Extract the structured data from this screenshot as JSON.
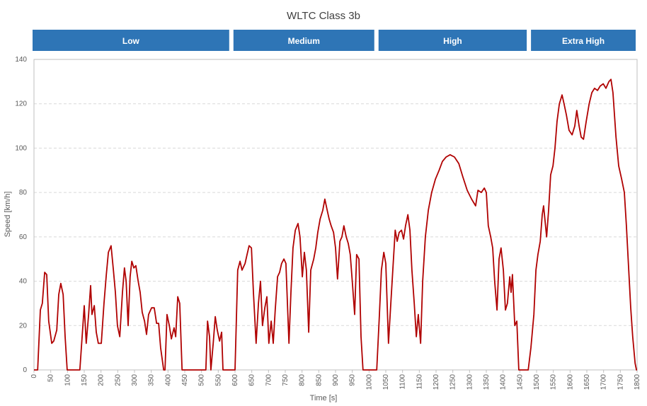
{
  "chart_data": {
    "type": "line",
    "title": "WLTC Class 3b",
    "xlabel": "Time [s]",
    "ylabel": "Speed [km/h]",
    "xlim": [
      0,
      1800
    ],
    "ylim": [
      0,
      140
    ],
    "xticks": [
      0,
      50,
      100,
      150,
      200,
      250,
      300,
      350,
      400,
      450,
      500,
      550,
      600,
      650,
      700,
      750,
      800,
      850,
      900,
      950,
      1000,
      1050,
      1100,
      1150,
      1200,
      1250,
      1300,
      1350,
      1400,
      1450,
      1500,
      1550,
      1600,
      1650,
      1700,
      1750,
      1800
    ],
    "yticks": [
      0,
      20,
      40,
      60,
      80,
      100,
      120,
      140
    ],
    "grid": "horizontal dashed",
    "line_color": "#b00000",
    "phase_color": "#2e75b6",
    "phases": [
      {
        "label": "Low",
        "start": 0,
        "end": 589
      },
      {
        "label": "Medium",
        "start": 589,
        "end": 1022
      },
      {
        "label": "High",
        "start": 1022,
        "end": 1477
      },
      {
        "label": "Extra High",
        "start": 1477,
        "end": 1800
      }
    ],
    "points": [
      [
        0,
        0
      ],
      [
        11,
        0
      ],
      [
        19,
        27
      ],
      [
        25,
        30
      ],
      [
        32,
        44
      ],
      [
        38,
        43
      ],
      [
        44,
        22
      ],
      [
        53,
        12
      ],
      [
        59,
        13
      ],
      [
        68,
        18
      ],
      [
        74,
        34
      ],
      [
        80,
        39
      ],
      [
        87,
        34
      ],
      [
        93,
        15
      ],
      [
        99,
        0
      ],
      [
        137,
        0
      ],
      [
        146,
        20
      ],
      [
        150,
        29
      ],
      [
        156,
        12
      ],
      [
        163,
        25
      ],
      [
        169,
        38
      ],
      [
        173,
        25
      ],
      [
        180,
        29
      ],
      [
        186,
        17
      ],
      [
        192,
        12
      ],
      [
        201,
        12
      ],
      [
        209,
        30
      ],
      [
        216,
        43
      ],
      [
        222,
        53
      ],
      [
        230,
        56
      ],
      [
        237,
        45
      ],
      [
        243,
        35
      ],
      [
        249,
        20
      ],
      [
        256,
        15
      ],
      [
        264,
        35
      ],
      [
        270,
        46
      ],
      [
        275,
        40
      ],
      [
        281,
        20
      ],
      [
        287,
        42
      ],
      [
        292,
        49
      ],
      [
        298,
        46
      ],
      [
        304,
        47
      ],
      [
        311,
        40
      ],
      [
        317,
        35
      ],
      [
        323,
        26
      ],
      [
        330,
        22
      ],
      [
        336,
        16
      ],
      [
        342,
        25
      ],
      [
        351,
        28
      ],
      [
        359,
        28
      ],
      [
        366,
        21
      ],
      [
        372,
        21
      ],
      [
        378,
        10
      ],
      [
        387,
        0
      ],
      [
        391,
        0
      ],
      [
        397,
        25
      ],
      [
        404,
        20
      ],
      [
        410,
        14
      ],
      [
        418,
        19
      ],
      [
        423,
        15
      ],
      [
        429,
        33
      ],
      [
        435,
        30
      ],
      [
        442,
        0
      ],
      [
        513,
        0
      ],
      [
        518,
        22
      ],
      [
        524,
        15
      ],
      [
        528,
        0
      ],
      [
        535,
        12
      ],
      [
        541,
        24
      ],
      [
        547,
        18
      ],
      [
        554,
        13
      ],
      [
        560,
        17
      ],
      [
        564,
        0
      ],
      [
        600,
        0
      ],
      [
        608,
        45
      ],
      [
        615,
        49
      ],
      [
        621,
        45
      ],
      [
        630,
        48
      ],
      [
        636,
        52
      ],
      [
        642,
        56
      ],
      [
        649,
        55
      ],
      [
        655,
        35
      ],
      [
        663,
        12
      ],
      [
        670,
        30
      ],
      [
        676,
        40
      ],
      [
        682,
        20
      ],
      [
        689,
        28
      ],
      [
        695,
        33
      ],
      [
        701,
        12
      ],
      [
        708,
        22
      ],
      [
        714,
        12
      ],
      [
        720,
        27
      ],
      [
        727,
        42
      ],
      [
        733,
        44
      ],
      [
        739,
        48
      ],
      [
        746,
        50
      ],
      [
        752,
        48
      ],
      [
        761,
        12
      ],
      [
        767,
        35
      ],
      [
        773,
        55
      ],
      [
        780,
        63
      ],
      [
        788,
        66
      ],
      [
        794,
        60
      ],
      [
        801,
        42
      ],
      [
        807,
        53
      ],
      [
        813,
        45
      ],
      [
        820,
        17
      ],
      [
        826,
        45
      ],
      [
        835,
        50
      ],
      [
        841,
        55
      ],
      [
        847,
        62
      ],
      [
        854,
        68
      ],
      [
        862,
        72
      ],
      [
        868,
        77
      ],
      [
        875,
        72
      ],
      [
        881,
        68
      ],
      [
        887,
        65
      ],
      [
        894,
        62
      ],
      [
        900,
        55
      ],
      [
        906,
        41
      ],
      [
        913,
        58
      ],
      [
        919,
        60
      ],
      [
        925,
        65
      ],
      [
        932,
        60
      ],
      [
        938,
        57
      ],
      [
        944,
        52
      ],
      [
        951,
        38
      ],
      [
        957,
        25
      ],
      [
        963,
        52
      ],
      [
        970,
        50
      ],
      [
        976,
        15
      ],
      [
        982,
        0
      ],
      [
        1023,
        0
      ],
      [
        1031,
        25
      ],
      [
        1037,
        45
      ],
      [
        1044,
        53
      ],
      [
        1050,
        48
      ],
      [
        1058,
        12
      ],
      [
        1065,
        30
      ],
      [
        1071,
        45
      ],
      [
        1078,
        63
      ],
      [
        1084,
        58
      ],
      [
        1090,
        62
      ],
      [
        1097,
        63
      ],
      [
        1103,
        59
      ],
      [
        1109,
        65
      ],
      [
        1116,
        70
      ],
      [
        1122,
        63
      ],
      [
        1128,
        45
      ],
      [
        1135,
        30
      ],
      [
        1141,
        15
      ],
      [
        1147,
        25
      ],
      [
        1154,
        12
      ],
      [
        1160,
        40
      ],
      [
        1168,
        60
      ],
      [
        1177,
        72
      ],
      [
        1187,
        80
      ],
      [
        1198,
        86
      ],
      [
        1209,
        90
      ],
      [
        1219,
        94
      ],
      [
        1230,
        96
      ],
      [
        1242,
        97
      ],
      [
        1255,
        96
      ],
      [
        1268,
        93
      ],
      [
        1280,
        87
      ],
      [
        1293,
        81
      ],
      [
        1306,
        77
      ],
      [
        1318,
        74
      ],
      [
        1325,
        81
      ],
      [
        1335,
        80
      ],
      [
        1344,
        82
      ],
      [
        1350,
        80
      ],
      [
        1356,
        65
      ],
      [
        1363,
        60
      ],
      [
        1369,
        55
      ],
      [
        1375,
        40
      ],
      [
        1382,
        27
      ],
      [
        1388,
        50
      ],
      [
        1394,
        55
      ],
      [
        1401,
        45
      ],
      [
        1407,
        27
      ],
      [
        1413,
        30
      ],
      [
        1420,
        42
      ],
      [
        1424,
        35
      ],
      [
        1428,
        43
      ],
      [
        1435,
        20
      ],
      [
        1441,
        22
      ],
      [
        1447,
        0
      ],
      [
        1475,
        0
      ],
      [
        1483,
        10
      ],
      [
        1492,
        25
      ],
      [
        1498,
        45
      ],
      [
        1504,
        52
      ],
      [
        1511,
        58
      ],
      [
        1517,
        70
      ],
      [
        1521,
        74
      ],
      [
        1530,
        60
      ],
      [
        1536,
        72
      ],
      [
        1542,
        88
      ],
      [
        1549,
        92
      ],
      [
        1555,
        100
      ],
      [
        1561,
        112
      ],
      [
        1568,
        120
      ],
      [
        1576,
        124
      ],
      [
        1582,
        120
      ],
      [
        1589,
        115
      ],
      [
        1597,
        108
      ],
      [
        1606,
        106
      ],
      [
        1614,
        110
      ],
      [
        1620,
        117
      ],
      [
        1627,
        110
      ],
      [
        1633,
        105
      ],
      [
        1640,
        104
      ],
      [
        1648,
        112
      ],
      [
        1657,
        120
      ],
      [
        1665,
        125
      ],
      [
        1673,
        127
      ],
      [
        1682,
        126
      ],
      [
        1690,
        128
      ],
      [
        1699,
        129
      ],
      [
        1707,
        127
      ],
      [
        1716,
        130
      ],
      [
        1722,
        131
      ],
      [
        1728,
        125
      ],
      [
        1737,
        105
      ],
      [
        1745,
        92
      ],
      [
        1754,
        86
      ],
      [
        1762,
        80
      ],
      [
        1768,
        65
      ],
      [
        1775,
        45
      ],
      [
        1781,
        28
      ],
      [
        1787,
        15
      ],
      [
        1794,
        3
      ],
      [
        1798,
        0
      ],
      [
        1800,
        0
      ]
    ]
  }
}
